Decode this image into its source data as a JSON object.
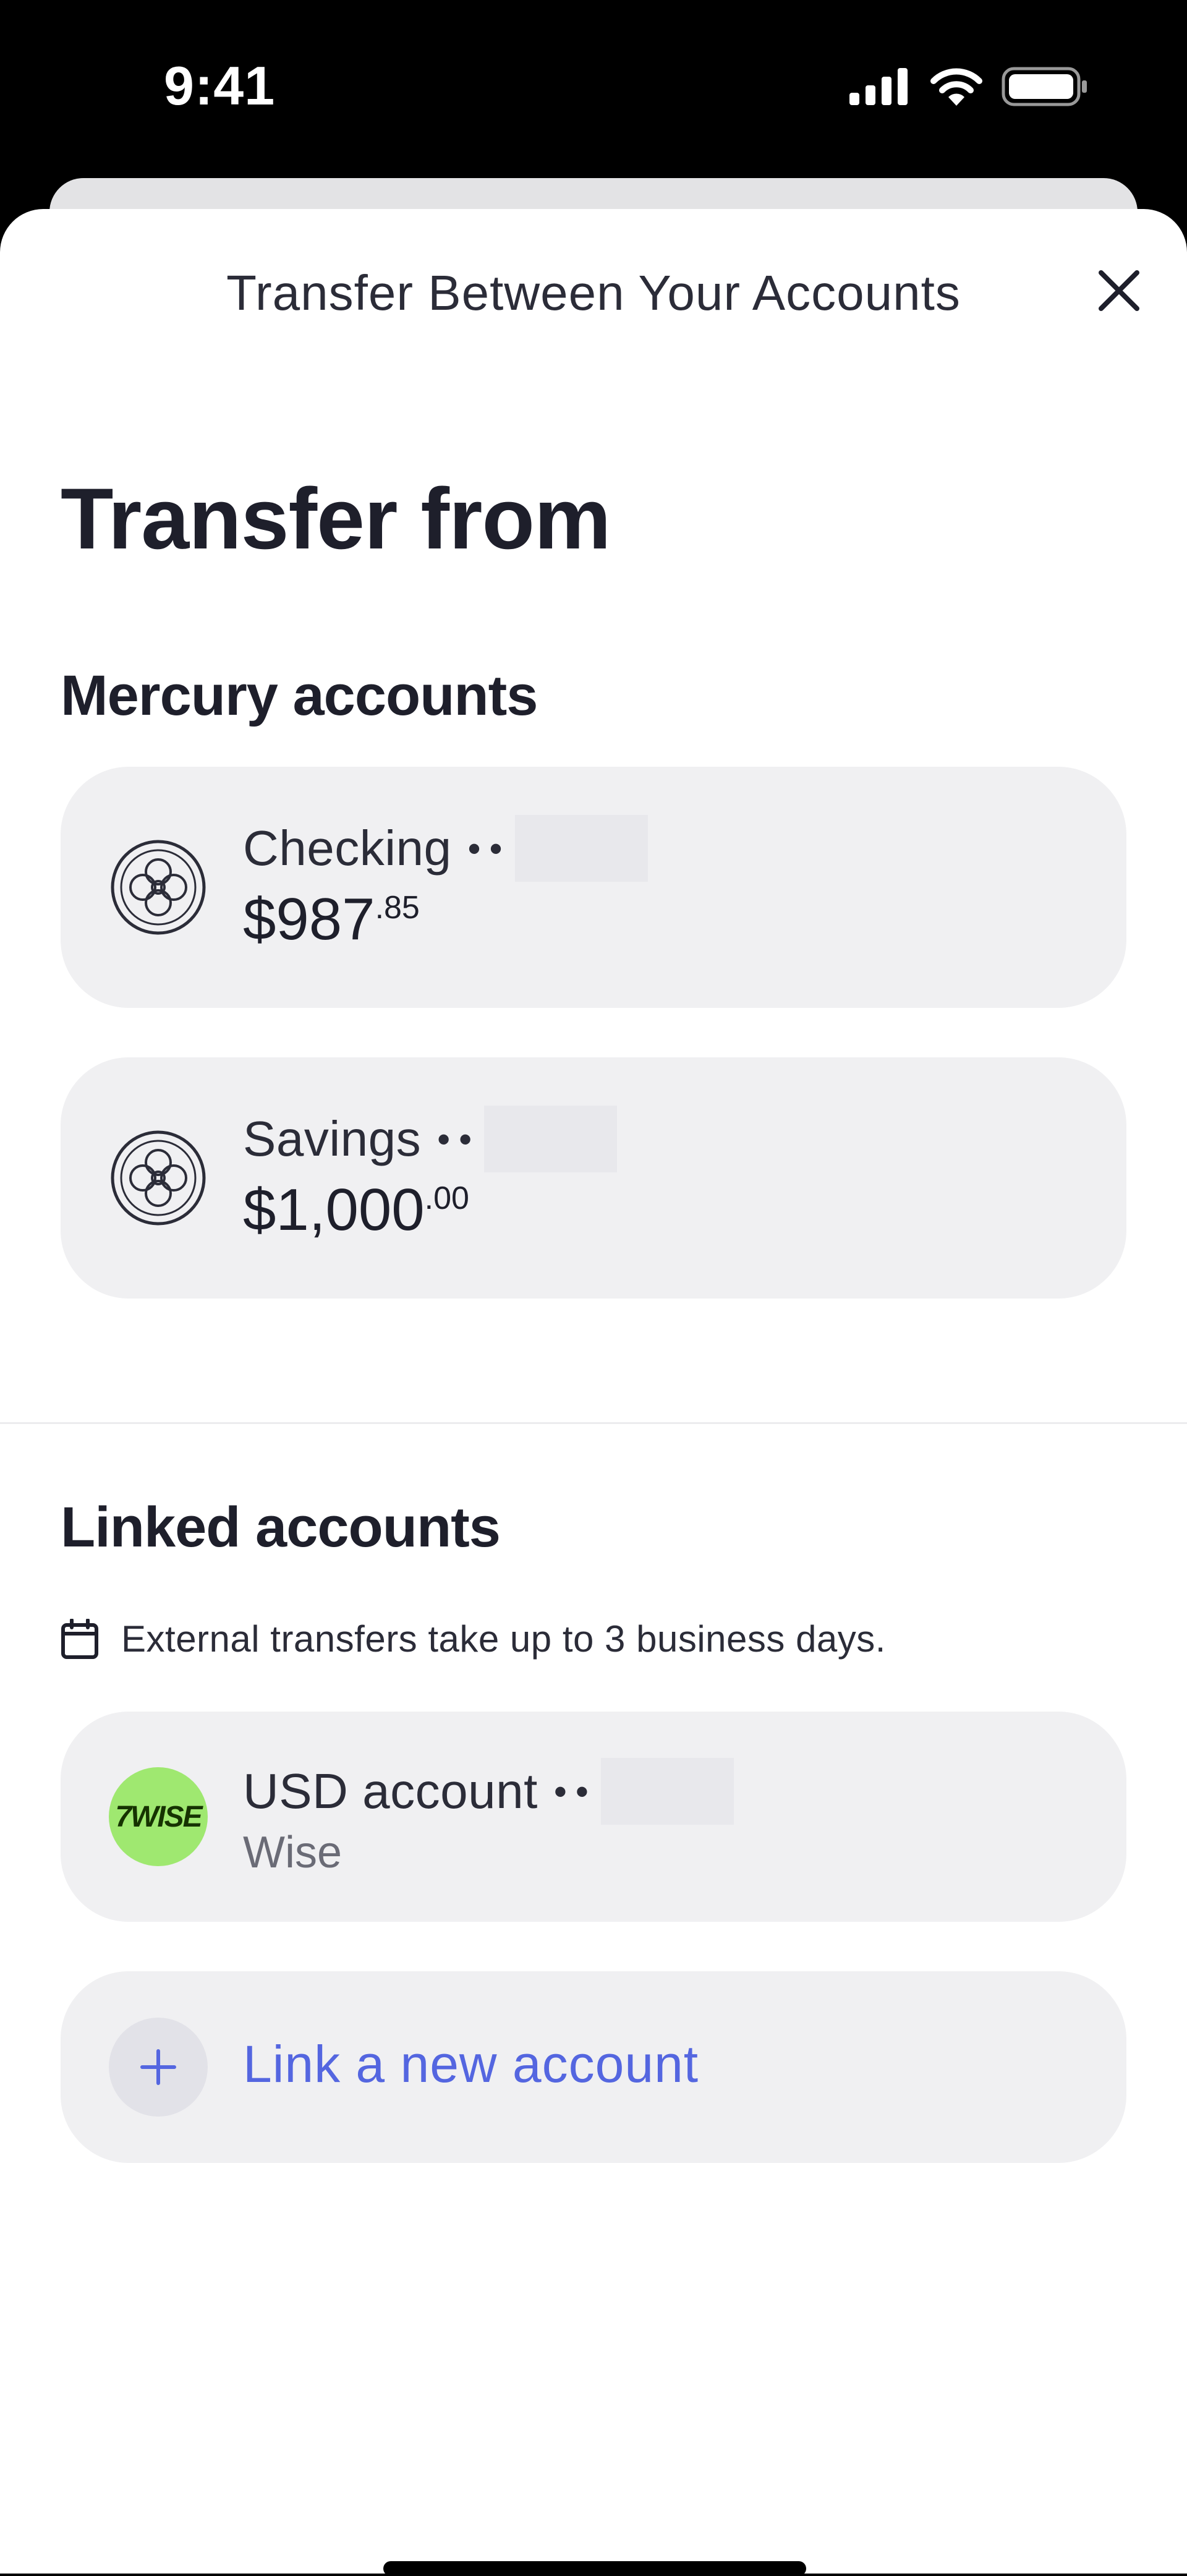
{
  "status_bar": {
    "time": "9:41"
  },
  "header": {
    "title": "Transfer Between Your Accounts",
    "close_icon": "close-icon"
  },
  "page_title": "Transfer from",
  "mercury": {
    "title": "Mercury accounts",
    "accounts": [
      {
        "name": "Checking",
        "dots": "••",
        "balance_main": "$987",
        "balance_cents": ".85",
        "icon": "mercury-logo-icon"
      },
      {
        "name": "Savings",
        "dots": "••",
        "balance_main": "$1,000",
        "balance_cents": ".00",
        "icon": "mercury-logo-icon"
      }
    ]
  },
  "linked": {
    "title": "Linked accounts",
    "note": "External transfers take up to 3 business days.",
    "accounts": [
      {
        "name": "USD account",
        "dots": "••",
        "institution": "Wise",
        "logo_text": "7WISE",
        "logo_color": "#9fe870"
      }
    ],
    "link_new_label": "Link a new account"
  },
  "colors": {
    "accent": "#5466e0",
    "card_bg": "#f0f0f2"
  }
}
